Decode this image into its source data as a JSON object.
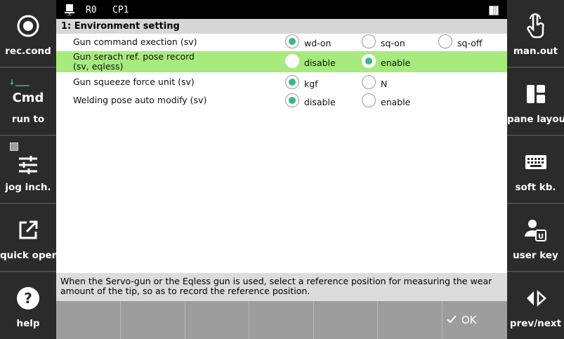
{
  "left_panel": {
    "buttons": [
      {
        "label": "rec.cond",
        "icon": "record-icon"
      },
      {
        "label": "run to",
        "icon": "cmd-icon",
        "badge": "Cmd"
      },
      {
        "label": "jog inch.",
        "icon": "sliders-icon"
      },
      {
        "label": "quick open",
        "icon": "external-link-icon"
      },
      {
        "label": "help",
        "icon": "help-icon"
      }
    ]
  },
  "right_panel": {
    "buttons": [
      {
        "label": "man.out",
        "icon": "hand-pointer-icon"
      },
      {
        "label": "pane layout",
        "icon": "layout-icon"
      },
      {
        "label": "soft kb.",
        "icon": "keyboard-icon"
      },
      {
        "label": "user key",
        "icon": "user-key-icon"
      },
      {
        "label": "prev/next",
        "icon": "prev-next-icon"
      }
    ]
  },
  "status_bar": {
    "robot": "R0",
    "program": "CP1"
  },
  "title": "1: Environment setting",
  "settings": [
    {
      "label": "Gun command exection (sv)",
      "options": [
        "wd-on",
        "sq-on",
        "sq-off"
      ],
      "selected": 0
    },
    {
      "label_line1": "Gun serach ref. pose record",
      "label_line2": "(sv, eqless)",
      "options": [
        "disable",
        "enable"
      ],
      "selected": 1
    },
    {
      "label": "Gun squeeze force unit (sv)",
      "options": [
        "kgf",
        "N"
      ],
      "selected": 0
    },
    {
      "label": "Welding pose auto modify (sv)",
      "options": [
        "disable",
        "enable"
      ],
      "selected": 0
    }
  ],
  "help_text": {
    "line1": "When the Servo-gun or the Eqless gun is used, select a reference position for measuring the wear",
    "line2": "amount of the tip, so as to record the reference position."
  },
  "footer": {
    "ok_label": "OK"
  },
  "colors": {
    "highlight": "#a7ea7e",
    "radio_selected": "#3bb68a",
    "side_panel": "#2b2b2b"
  }
}
